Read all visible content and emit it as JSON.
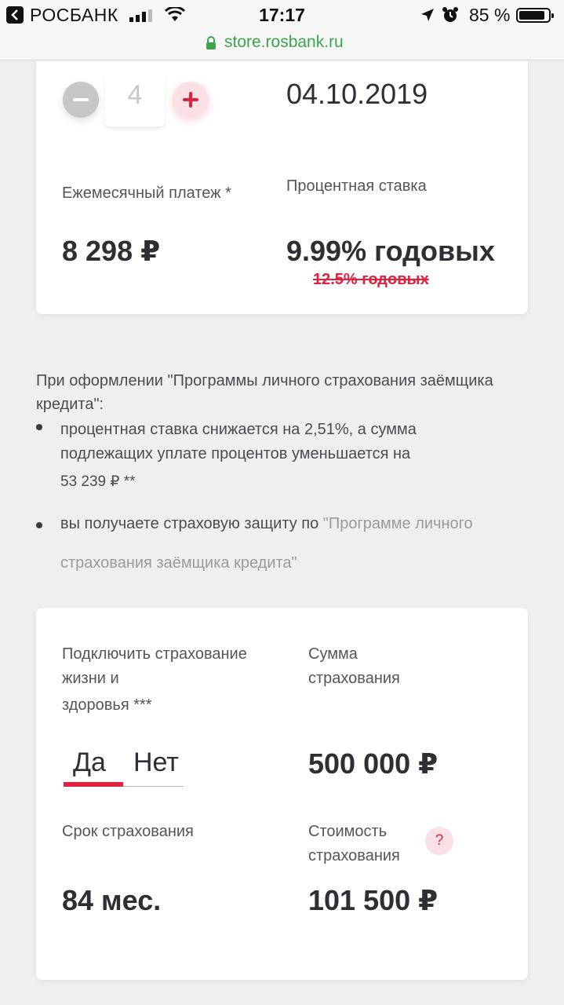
{
  "status_bar": {
    "carrier": "РОСБАНК",
    "time": "17:17",
    "battery": "85 %"
  },
  "browser": {
    "url": "store.rosbank.ru"
  },
  "loan_card": {
    "stepper_value": "4",
    "date": "04.10.2019",
    "monthly_payment_label": "Ежемесячный платеж *",
    "monthly_payment_value": "8 298 ₽",
    "rate_label": "Процентная ставка",
    "rate_value": "9.99% годовых",
    "old_rate": "12.5% годовых"
  },
  "insurance_info": {
    "intro": "При оформлении \"Программы личного страхования заёмщика кредита\":",
    "bullet1_text": "процентная ставка снижается на 2,51%, а сумма подлежащих уплате процентов уменьшается на",
    "bullet1_amount": "53 239 ₽ **",
    "bullet2_text": "вы получаете страховую защиту по",
    "bullet2_link_part1": "\"Программе личного",
    "bullet2_link_part2": "страхования заёмщика кредита\""
  },
  "insurance_card": {
    "connect_label": "Подключить страхование жизни и",
    "connect_label_line3": "здоровья ***",
    "option_yes": "Да",
    "option_no": "Нет",
    "sum_label": "Сумма страхования",
    "sum_value": "500 000 ₽",
    "term_label": "Срок страхования",
    "term_value": "84 мес.",
    "cost_label": "Стоимость страхования",
    "cost_value": "101 500 ₽",
    "help_symbol": "?"
  }
}
